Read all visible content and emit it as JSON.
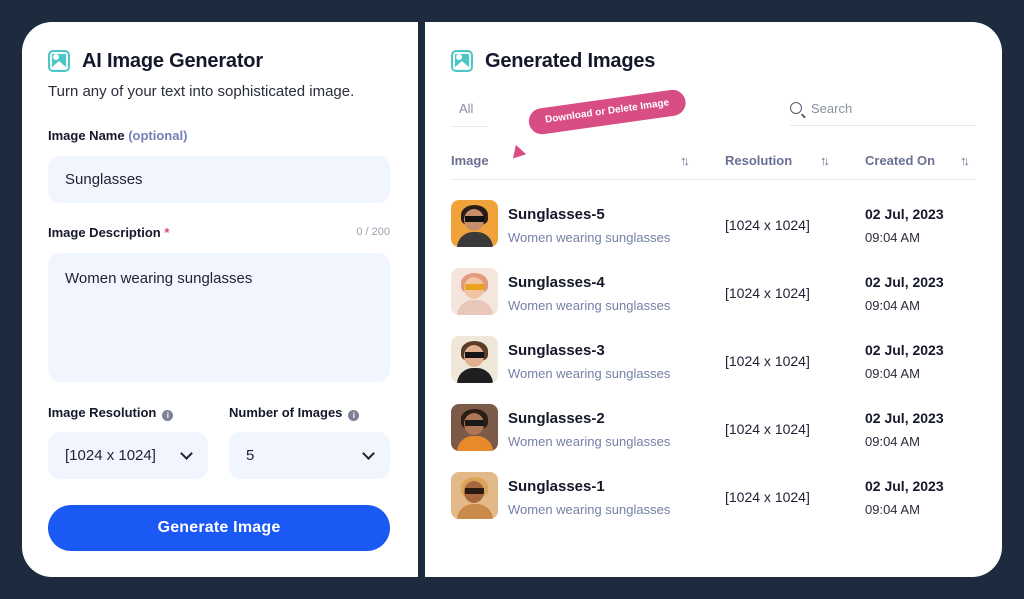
{
  "generator": {
    "title": "AI Image Generator",
    "subtitle": "Turn any of your text into sophisticated image.",
    "name_label": "Image Name",
    "name_optional": "(optional)",
    "name_value": "Sunglasses",
    "description_label": "Image Description",
    "description_required_mark": "*",
    "description_counter": "0 / 200",
    "description_value": "Women wearing sunglasses",
    "resolution_label": "Image Resolution",
    "resolution_value": "[1024 x 1024]",
    "count_label": "Number of Images",
    "count_value": "5",
    "generate_button": "Generate Image",
    "icon": "image-icon"
  },
  "gallery": {
    "title": "Generated Images",
    "tab_all": "All",
    "search_placeholder": "Search",
    "tooltip": "Download or Delete Image",
    "columns": {
      "image": "Image",
      "resolution": "Resolution",
      "created": "Created On"
    },
    "rows": [
      {
        "name": "Sunglasses-5",
        "description": "Women wearing sunglasses",
        "resolution": "[1024 x 1024]",
        "date": "02 Jul, 2023",
        "time": "09:04 AM"
      },
      {
        "name": "Sunglasses-4",
        "description": "Women wearing sunglasses",
        "resolution": "[1024 x 1024]",
        "date": "02 Jul, 2023",
        "time": "09:04 AM"
      },
      {
        "name": "Sunglasses-3",
        "description": "Women wearing sunglasses",
        "resolution": "[1024 x 1024]",
        "date": "02 Jul, 2023",
        "time": "09:04 AM"
      },
      {
        "name": "Sunglasses-2",
        "description": "Women wearing sunglasses",
        "resolution": "[1024 x 1024]",
        "date": "02 Jul, 2023",
        "time": "09:04 AM"
      },
      {
        "name": "Sunglasses-1",
        "description": "Women wearing sunglasses",
        "resolution": "[1024 x 1024]",
        "date": "02 Jul, 2023",
        "time": "09:04 AM"
      }
    ]
  },
  "colors": {
    "frame": "#1e2b3e",
    "primary_button": "#1b59f5",
    "field_background": "#f1f5fe",
    "tooltip": "#d94d85",
    "accent_icon": "#4fc6c6"
  }
}
